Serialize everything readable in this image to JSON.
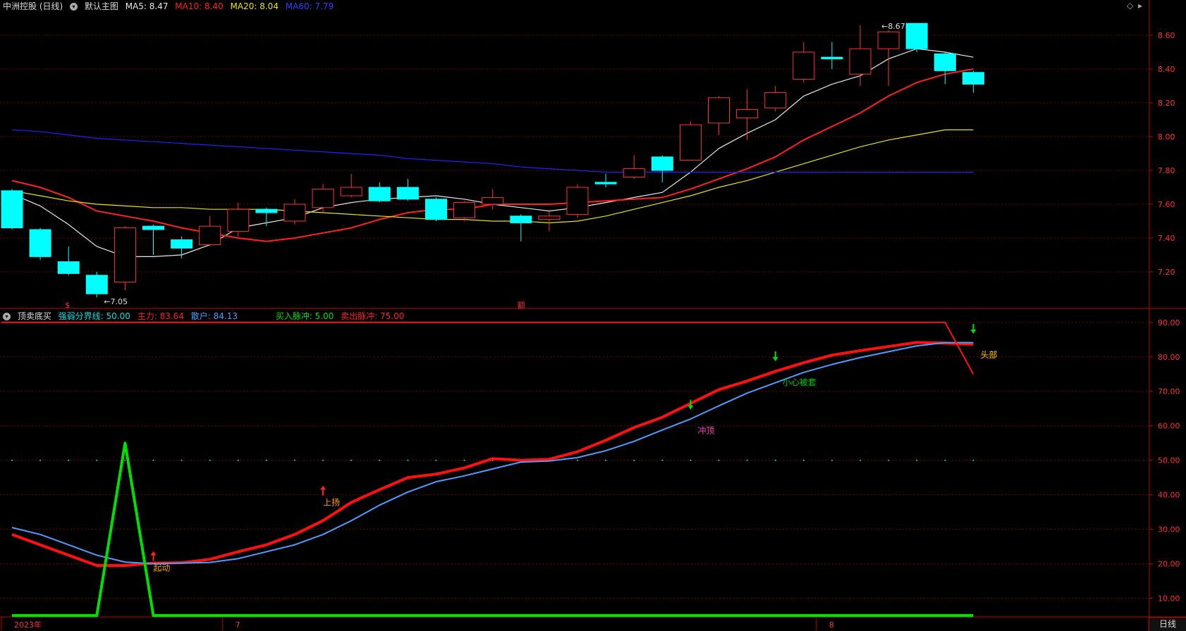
{
  "main_header": {
    "stock_title": "中洲控股 (日线)",
    "template_label": "默认主图",
    "ma5": "MA5: 8.47",
    "ma10": "MA10: 8.40",
    "ma20": "MA20: 8.04",
    "ma60": "MA60: 7.79"
  },
  "sub_header": {
    "indicator_name": "顶卖底买",
    "threshold": "强弱分界线: 50.00",
    "main_force": "主力: 83.64",
    "retail": "散户: 84.13",
    "buy_pulse": "买入脉冲: 5.00",
    "sell_pulse": "卖出脉冲: 75.00"
  },
  "period_tab": "日线",
  "colors": {
    "up": "#ff3232",
    "down": "#00ffff",
    "ma5": "#e8e8e8",
    "ma10": "#ff2020",
    "ma20": "#e6e600",
    "ma60": "#2020ff",
    "grid": "#7a0000",
    "axis": "#c00000",
    "main_force": "#ff1010",
    "retail": "#4f9cff",
    "pulse": "#00e000",
    "label_yellow": "#ffcc00",
    "label_orange": "#ff9900",
    "label_magenta": "#ff3fbf",
    "label_green": "#00cc00"
  },
  "chart_data": [
    {
      "type": "candlestick",
      "title": "中洲控股 (日线)",
      "ylim": [
        7.0,
        8.75
      ],
      "y_ticks": [
        "8.60",
        "8.40",
        "8.20",
        "8.00",
        "7.80",
        "7.60",
        "7.40",
        "7.20"
      ],
      "x_tick_labels": [
        {
          "index": 0,
          "label": "2023年"
        },
        {
          "index": 8,
          "label": "7"
        },
        {
          "index": 29,
          "label": "8"
        }
      ],
      "candles": [
        {
          "open": 7.68,
          "close": 7.46,
          "high": 7.69,
          "low": 7.45
        },
        {
          "open": 7.45,
          "close": 7.29,
          "high": 7.46,
          "low": 7.27
        },
        {
          "open": 7.26,
          "close": 7.19,
          "high": 7.35,
          "low": 7.18
        },
        {
          "open": 7.18,
          "close": 7.07,
          "high": 7.2,
          "low": 7.05
        },
        {
          "open": 7.14,
          "close": 7.46,
          "high": 7.47,
          "low": 7.09
        },
        {
          "open": 7.47,
          "close": 7.45,
          "high": 7.48,
          "low": 7.3
        },
        {
          "open": 7.39,
          "close": 7.34,
          "high": 7.41,
          "low": 7.28
        },
        {
          "open": 7.36,
          "close": 7.47,
          "high": 7.53,
          "low": 7.35
        },
        {
          "open": 7.44,
          "close": 7.57,
          "high": 7.61,
          "low": 7.41
        },
        {
          "open": 7.57,
          "close": 7.55,
          "high": 7.58,
          "low": 7.47
        },
        {
          "open": 7.5,
          "close": 7.6,
          "high": 7.63,
          "low": 7.48
        },
        {
          "open": 7.58,
          "close": 7.69,
          "high": 7.72,
          "low": 7.55
        },
        {
          "open": 7.65,
          "close": 7.7,
          "high": 7.78,
          "low": 7.64
        },
        {
          "open": 7.7,
          "close": 7.62,
          "high": 7.73,
          "low": 7.61
        },
        {
          "open": 7.7,
          "close": 7.63,
          "high": 7.75,
          "low": 7.62
        },
        {
          "open": 7.63,
          "close": 7.51,
          "high": 7.64,
          "low": 7.5
        },
        {
          "open": 7.52,
          "close": 7.61,
          "high": 7.62,
          "low": 7.5
        },
        {
          "open": 7.6,
          "close": 7.64,
          "high": 7.69,
          "low": 7.57
        },
        {
          "open": 7.53,
          "close": 7.49,
          "high": 7.54,
          "low": 7.38
        },
        {
          "open": 7.51,
          "close": 7.53,
          "high": 7.56,
          "low": 7.44
        },
        {
          "open": 7.54,
          "close": 7.7,
          "high": 7.72,
          "low": 7.52
        },
        {
          "open": 7.73,
          "close": 7.72,
          "high": 7.78,
          "low": 7.7
        },
        {
          "open": 7.76,
          "close": 7.81,
          "high": 7.89,
          "low": 7.75
        },
        {
          "open": 7.88,
          "close": 7.8,
          "high": 7.89,
          "low": 7.73
        },
        {
          "open": 7.86,
          "close": 8.07,
          "high": 8.09,
          "low": 7.86
        },
        {
          "open": 8.08,
          "close": 8.23,
          "high": 8.24,
          "low": 8.01
        },
        {
          "open": 8.11,
          "close": 8.16,
          "high": 8.28,
          "low": 7.98
        },
        {
          "open": 8.17,
          "close": 8.26,
          "high": 8.3,
          "low": 8.15
        },
        {
          "open": 8.34,
          "close": 8.5,
          "high": 8.56,
          "low": 8.32
        },
        {
          "open": 8.47,
          "close": 8.46,
          "high": 8.56,
          "low": 8.4
        },
        {
          "open": 8.37,
          "close": 8.52,
          "high": 8.66,
          "low": 8.3
        },
        {
          "open": 8.52,
          "close": 8.62,
          "high": 8.63,
          "low": 8.3
        },
        {
          "open": 8.67,
          "close": 8.52,
          "high": 8.67,
          "low": 8.5
        },
        {
          "open": 8.49,
          "close": 8.39,
          "high": 8.5,
          "low": 8.31
        },
        {
          "open": 8.38,
          "close": 8.31,
          "high": 8.39,
          "low": 8.26
        }
      ],
      "series": [
        {
          "name": "MA5",
          "values": [
            7.66,
            7.59,
            7.48,
            7.35,
            7.29,
            7.29,
            7.3,
            7.36,
            7.46,
            7.49,
            7.52,
            7.58,
            7.61,
            7.63,
            7.64,
            7.65,
            7.63,
            7.6,
            7.58,
            7.56,
            7.58,
            7.61,
            7.64,
            7.67,
            7.79,
            7.93,
            8.02,
            8.1,
            8.24,
            8.31,
            8.36,
            8.46,
            8.52,
            8.5,
            8.47
          ]
        },
        {
          "name": "MA10",
          "values": [
            7.74,
            7.7,
            7.64,
            7.56,
            7.53,
            7.5,
            7.46,
            7.43,
            7.4,
            7.38,
            7.4,
            7.43,
            7.46,
            7.51,
            7.55,
            7.57,
            7.57,
            7.6,
            7.6,
            7.6,
            7.61,
            7.62,
            7.63,
            7.64,
            7.69,
            7.75,
            7.81,
            7.88,
            7.98,
            8.06,
            8.14,
            8.24,
            8.32,
            8.37,
            8.4
          ]
        },
        {
          "name": "MA20",
          "values": [
            7.68,
            7.65,
            7.62,
            7.6,
            7.59,
            7.58,
            7.58,
            7.57,
            7.57,
            7.57,
            7.56,
            7.55,
            7.54,
            7.53,
            7.52,
            7.51,
            7.51,
            7.5,
            7.5,
            7.49,
            7.5,
            7.53,
            7.57,
            7.61,
            7.65,
            7.7,
            7.74,
            7.79,
            7.84,
            7.89,
            7.94,
            7.98,
            8.01,
            8.04,
            8.04
          ]
        },
        {
          "name": "MA60",
          "values": [
            8.04,
            8.03,
            8.01,
            7.99,
            7.98,
            7.97,
            7.96,
            7.95,
            7.94,
            7.93,
            7.92,
            7.91,
            7.9,
            7.89,
            7.87,
            7.86,
            7.85,
            7.84,
            7.82,
            7.81,
            7.8,
            7.79,
            7.79,
            7.79,
            7.79,
            7.79,
            7.79,
            7.79,
            7.79,
            7.79,
            7.79,
            7.79,
            7.79,
            7.79,
            7.79
          ]
        }
      ],
      "annotations": [
        {
          "index": 3,
          "text": "←7.05",
          "kind": "low"
        },
        {
          "index": 31,
          "text": "←8.67",
          "kind": "high"
        }
      ],
      "bottom_marks": [
        {
          "index": 2,
          "text": "$"
        },
        {
          "index": 18,
          "text": "额"
        }
      ]
    },
    {
      "type": "line",
      "title": "顶卖底买",
      "ylim": [
        5,
        92
      ],
      "y_ticks": [
        "90.00",
        "80.00",
        "70.00",
        "60.00",
        "50.00",
        "40.00",
        "30.00",
        "20.00",
        "10.00"
      ],
      "threshold": 50,
      "series": [
        {
          "name": "主力",
          "values": [
            28.5,
            25.5,
            22.5,
            19.5,
            19.5,
            20.2,
            20.3,
            21.3,
            23.5,
            25.5,
            28.5,
            32.5,
            37.8,
            41.5,
            45.0,
            46.0,
            47.8,
            50.5,
            50.0,
            50.3,
            52.5,
            55.8,
            59.5,
            62.5,
            66.5,
            70.5,
            73.0,
            75.8,
            78.3,
            80.5,
            81.8,
            83.0,
            84.2,
            84.0,
            83.64
          ]
        },
        {
          "name": "散户",
          "values": [
            30.5,
            28.5,
            25.5,
            22.5,
            20.5,
            20.0,
            20.2,
            20.4,
            21.5,
            23.5,
            25.5,
            28.5,
            32.5,
            37.0,
            40.8,
            43.8,
            45.5,
            47.5,
            49.5,
            49.8,
            50.8,
            52.8,
            55.5,
            58.8,
            62.0,
            65.8,
            69.5,
            72.5,
            75.5,
            77.8,
            79.8,
            81.5,
            83.2,
            84.13,
            84.13
          ]
        },
        {
          "name": "买入脉冲",
          "values": [
            5,
            5,
            5,
            5,
            55,
            5,
            5,
            5,
            5,
            5,
            5,
            5,
            5,
            5,
            5,
            5,
            5,
            5,
            5,
            5,
            5,
            5,
            5,
            5,
            5,
            5,
            5,
            5,
            5,
            5,
            5,
            5,
            5,
            5,
            5
          ]
        },
        {
          "name": "卖出脉冲",
          "values": [
            90,
            90,
            90,
            90,
            90,
            90,
            90,
            90,
            90,
            90,
            90,
            90,
            90,
            90,
            90,
            90,
            90,
            90,
            90,
            90,
            90,
            90,
            90,
            90,
            90,
            90,
            90,
            90,
            90,
            90,
            90,
            90,
            90,
            90,
            75
          ]
        }
      ],
      "annotations": [
        {
          "index": 5,
          "value": 20,
          "text": "起动",
          "color": "label_orange",
          "arrow": "up"
        },
        {
          "index": 11,
          "value": 39,
          "text": "上扬",
          "color": "label_orange",
          "arrow": "up"
        },
        {
          "index": 24,
          "value": 59,
          "text": "冲顶",
          "color": "label_magenta",
          "arrow": "down"
        },
        {
          "index": 27,
          "value": 73,
          "text": "小心被套",
          "color": "label_green",
          "arrow": "down"
        },
        {
          "index": 34,
          "value": 81,
          "text": "头部",
          "color": "label_yellow",
          "arrow": "down"
        }
      ]
    }
  ]
}
